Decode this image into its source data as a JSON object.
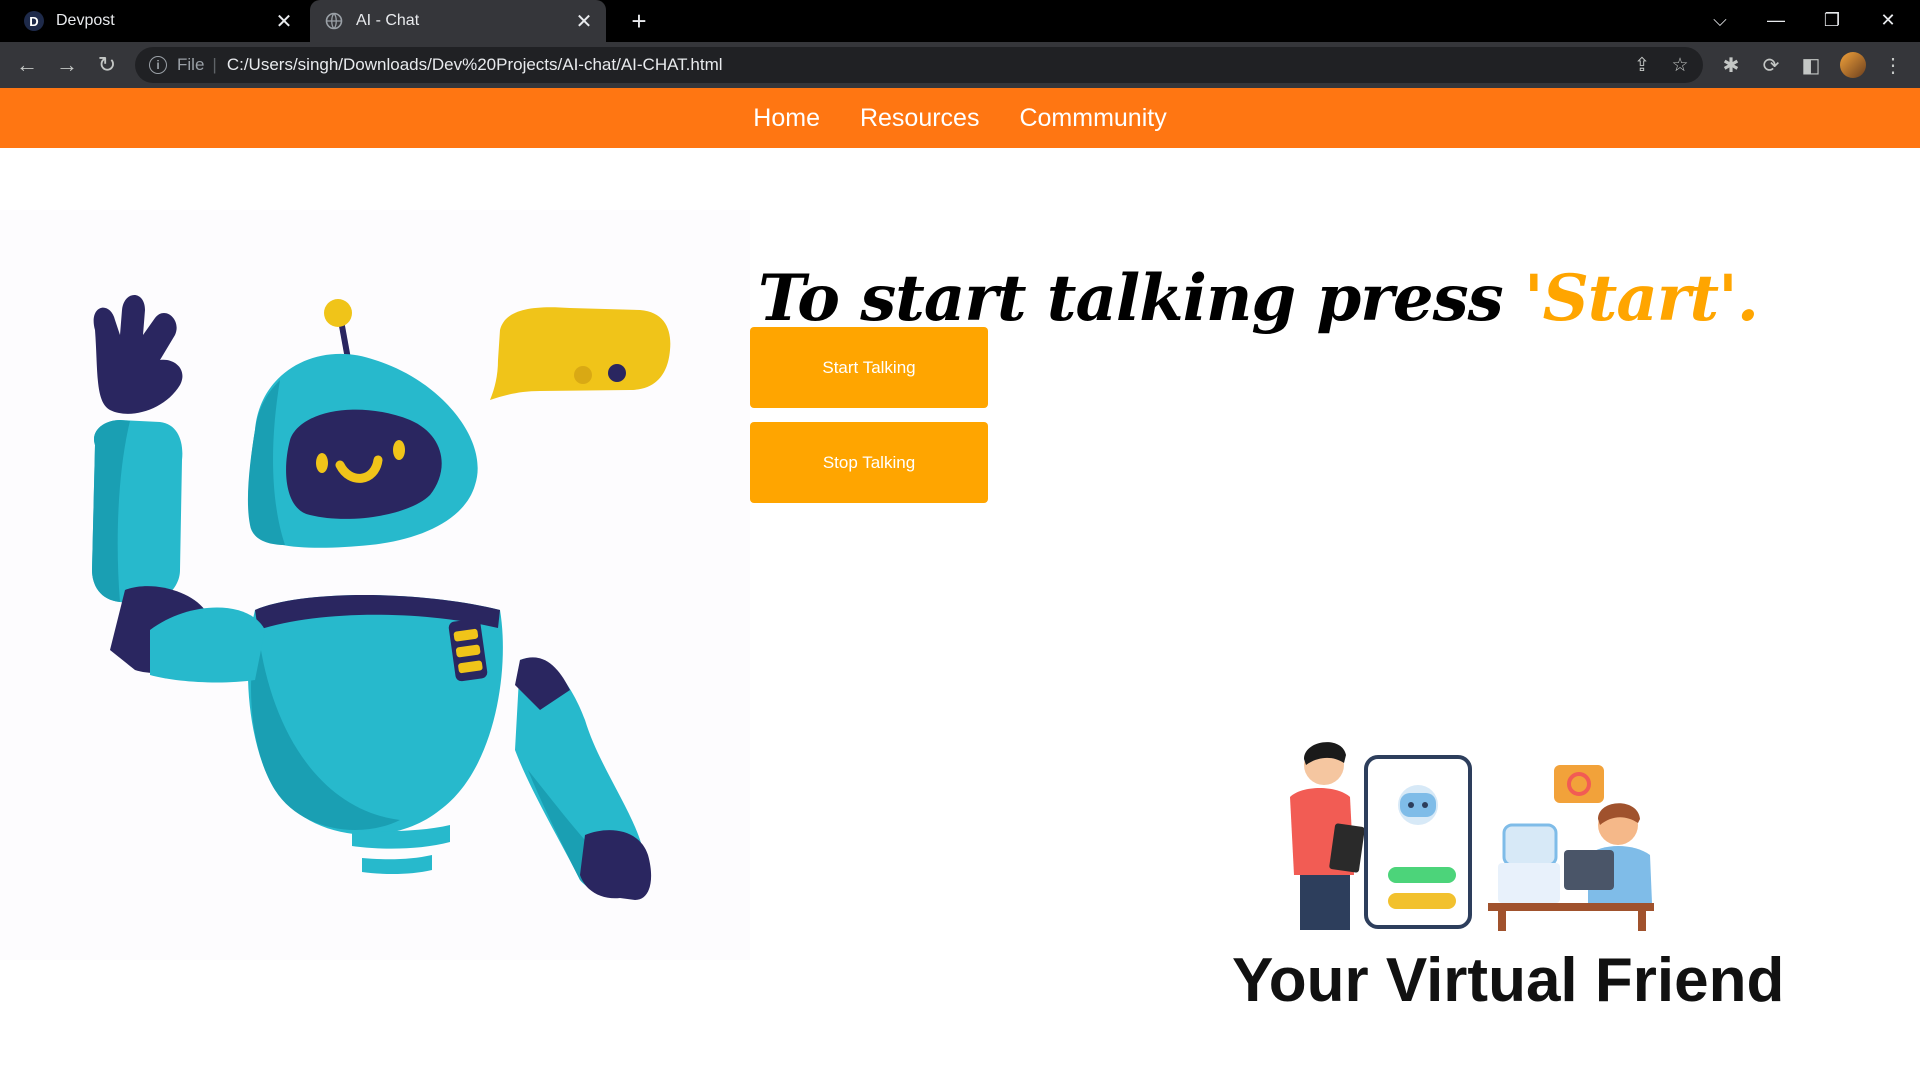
{
  "browser": {
    "tabs": [
      {
        "title": "Devpost",
        "favicon": "D",
        "active": false
      },
      {
        "title": "AI - Chat",
        "favicon": "globe-icon",
        "active": true
      }
    ],
    "address": {
      "scheme": "File",
      "url": "C:/Users/singh/Downloads/Dev%20Projects/AI-chat/AI-CHAT.html"
    }
  },
  "nav": {
    "items": [
      "Home",
      "Resources",
      "Commmunity"
    ],
    "background": "#ff7612"
  },
  "hero": {
    "headline": "To start talking press",
    "headline_accent": "'Start'.",
    "accent_color": "#ffa500"
  },
  "controls": {
    "start_label": "Start Talking",
    "stop_label": "Stop Talking",
    "button_color": "#ffa500"
  },
  "footer_banner": {
    "tagline": "Your Virtual Friend"
  }
}
